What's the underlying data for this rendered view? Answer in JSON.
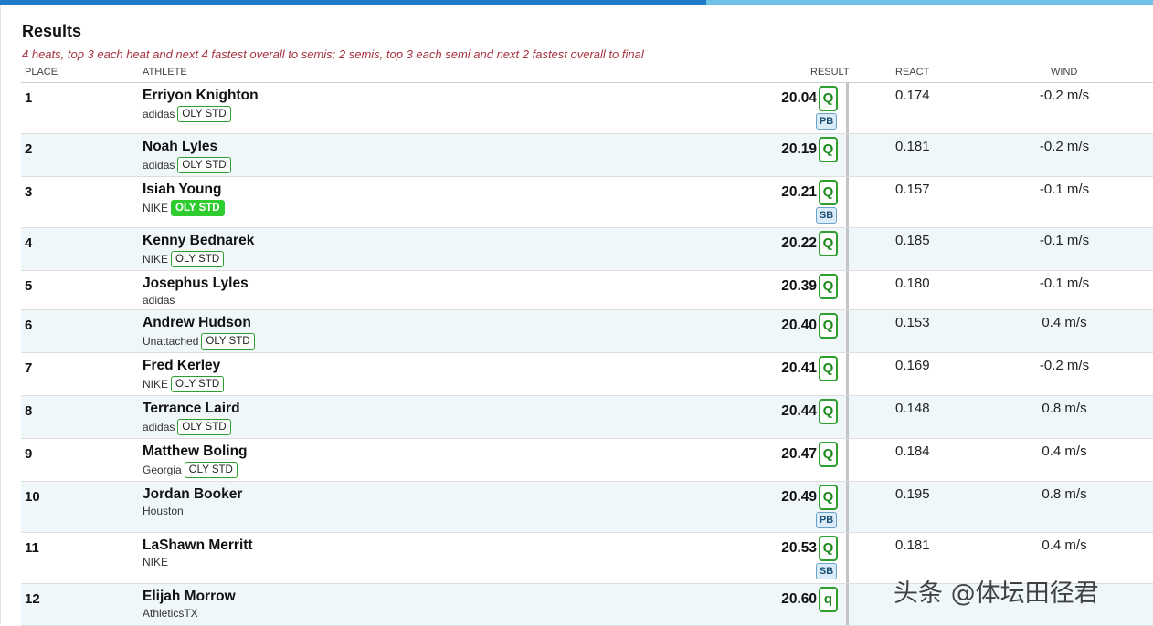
{
  "page": {
    "title": "Results",
    "description": "4 heats, top 3 each heat and next 4 fastest overall to semis; 2 semis, top 3 each semi and next 2 fastest overall to final"
  },
  "columns": {
    "place": "PLACE",
    "athlete": "ATHLETE",
    "result": "RESULT",
    "react": "REACT",
    "wind": "WIND"
  },
  "rows": [
    {
      "place": "1",
      "name": "Erriyon Knighton",
      "team": "adidas",
      "badge": "OLY STD",
      "badge_filled": false,
      "result": "20.04",
      "q": "Q",
      "record": "PB",
      "react": "0.174",
      "wind": "-0.2 m/s"
    },
    {
      "place": "2",
      "name": "Noah Lyles",
      "team": "adidas",
      "badge": "OLY STD",
      "badge_filled": false,
      "result": "20.19",
      "q": "Q",
      "record": "",
      "react": "0.181",
      "wind": "-0.2 m/s"
    },
    {
      "place": "3",
      "name": "Isiah Young",
      "team": "NIKE",
      "badge": "OLY STD",
      "badge_filled": true,
      "result": "20.21",
      "q": "Q",
      "record": "SB",
      "react": "0.157",
      "wind": "-0.1 m/s"
    },
    {
      "place": "4",
      "name": "Kenny Bednarek",
      "team": "NIKE",
      "badge": "OLY STD",
      "badge_filled": false,
      "result": "20.22",
      "q": "Q",
      "record": "",
      "react": "0.185",
      "wind": "-0.1 m/s"
    },
    {
      "place": "5",
      "name": "Josephus Lyles",
      "team": "adidas",
      "badge": "",
      "badge_filled": false,
      "result": "20.39",
      "q": "Q",
      "record": "",
      "react": "0.180",
      "wind": "-0.1 m/s"
    },
    {
      "place": "6",
      "name": "Andrew Hudson",
      "team": "Unattached",
      "badge": "OLY STD",
      "badge_filled": false,
      "result": "20.40",
      "q": "Q",
      "record": "",
      "react": "0.153",
      "wind": "0.4 m/s"
    },
    {
      "place": "7",
      "name": "Fred Kerley",
      "team": "NIKE",
      "badge": "OLY STD",
      "badge_filled": false,
      "result": "20.41",
      "q": "Q",
      "record": "",
      "react": "0.169",
      "wind": "-0.2 m/s"
    },
    {
      "place": "8",
      "name": "Terrance Laird",
      "team": "adidas",
      "badge": "OLY STD",
      "badge_filled": false,
      "result": "20.44",
      "q": "Q",
      "record": "",
      "react": "0.148",
      "wind": "0.8 m/s"
    },
    {
      "place": "9",
      "name": "Matthew Boling",
      "team": "Georgia",
      "badge": "OLY STD",
      "badge_filled": false,
      "result": "20.47",
      "q": "Q",
      "record": "",
      "react": "0.184",
      "wind": "0.4 m/s"
    },
    {
      "place": "10",
      "name": "Jordan Booker",
      "team": "Houston",
      "badge": "",
      "badge_filled": false,
      "result": "20.49",
      "q": "Q",
      "record": "PB",
      "react": "0.195",
      "wind": "0.8 m/s"
    },
    {
      "place": "11",
      "name": "LaShawn Merritt",
      "team": "NIKE",
      "badge": "",
      "badge_filled": false,
      "result": "20.53",
      "q": "Q",
      "record": "SB",
      "react": "0.181",
      "wind": "0.4 m/s"
    },
    {
      "place": "12",
      "name": "Elijah Morrow",
      "team": "AthleticsTX",
      "badge": "",
      "badge_filled": false,
      "result": "20.60",
      "q": "q",
      "record": "",
      "react": "",
      "wind": ""
    }
  ],
  "colors": {
    "accent_blue": "#1f7bc8",
    "qualify_green": "#2e9e2e",
    "description_red": "#a4323e",
    "alt_row": "#f0f7fb"
  },
  "watermark": "头条 @体坛田径君"
}
